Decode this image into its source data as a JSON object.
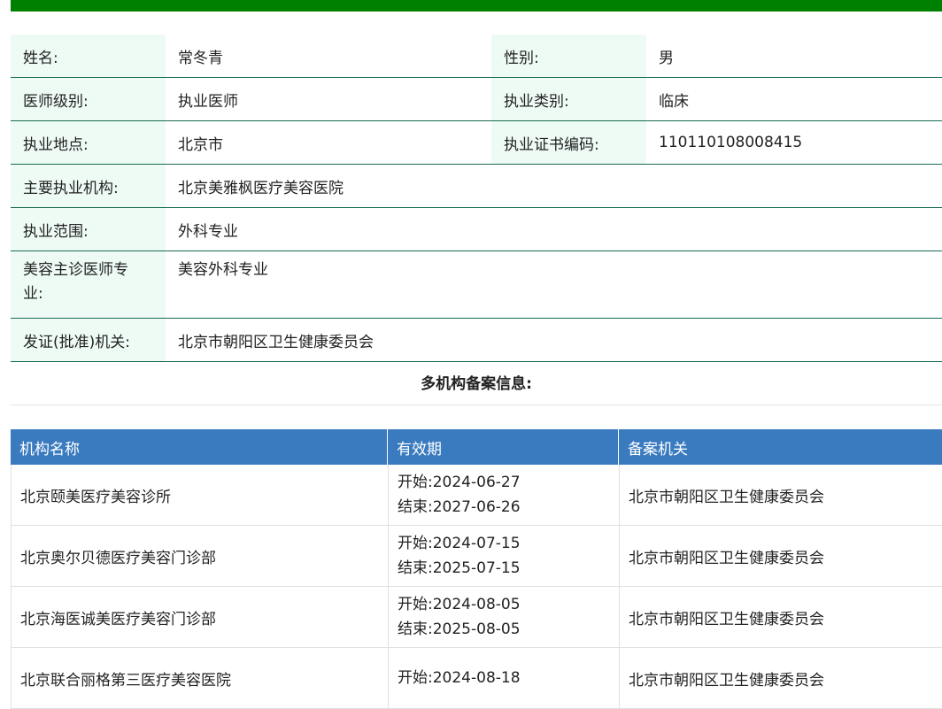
{
  "info": {
    "rows": [
      {
        "l1": "姓名:",
        "v1": "常冬青",
        "l2": "性别:",
        "v2": "男"
      },
      {
        "l1": "医师级别:",
        "v1": "执业医师",
        "l2": "执业类别:",
        "v2": "临床"
      },
      {
        "l1": "执业地点:",
        "v1": "北京市",
        "l2": "执业证书编码:",
        "v2": "110110108008415"
      }
    ],
    "main_institution_label": "主要执业机构:",
    "main_institution": "北京美雅枫医疗美容医院",
    "scope_label": "执业范围:",
    "scope": "外科专业",
    "specialty_label_1": "美容主诊医师专",
    "specialty_label_2": "业:",
    "specialty": "美容外科专业",
    "issuer_label": "发证(批准)机关:",
    "issuer": "北京市朝阳区卫生健康委员会"
  },
  "section_title": "多机构备案信息:",
  "table": {
    "headers": [
      "机构名称",
      "有效期",
      "备案机关"
    ],
    "rows": [
      {
        "name": "北京颐美医疗美容诊所",
        "start": "开始:2024-06-27",
        "end": "结束:2027-06-26",
        "authority": "北京市朝阳区卫生健康委员会"
      },
      {
        "name": "北京奥尔贝德医疗美容门诊部",
        "start": "开始:2024-07-15",
        "end": "结束:2025-07-15",
        "authority": "北京市朝阳区卫生健康委员会"
      },
      {
        "name": "北京海医诚美医疗美容门诊部",
        "start": "开始:2024-08-05",
        "end": "结束:2025-08-05",
        "authority": "北京市朝阳区卫生健康委员会"
      },
      {
        "name": "北京联合丽格第三医疗美容医院",
        "start": "开始:2024-08-18",
        "end": "",
        "authority": "北京市朝阳区卫生健康委员会"
      }
    ]
  }
}
